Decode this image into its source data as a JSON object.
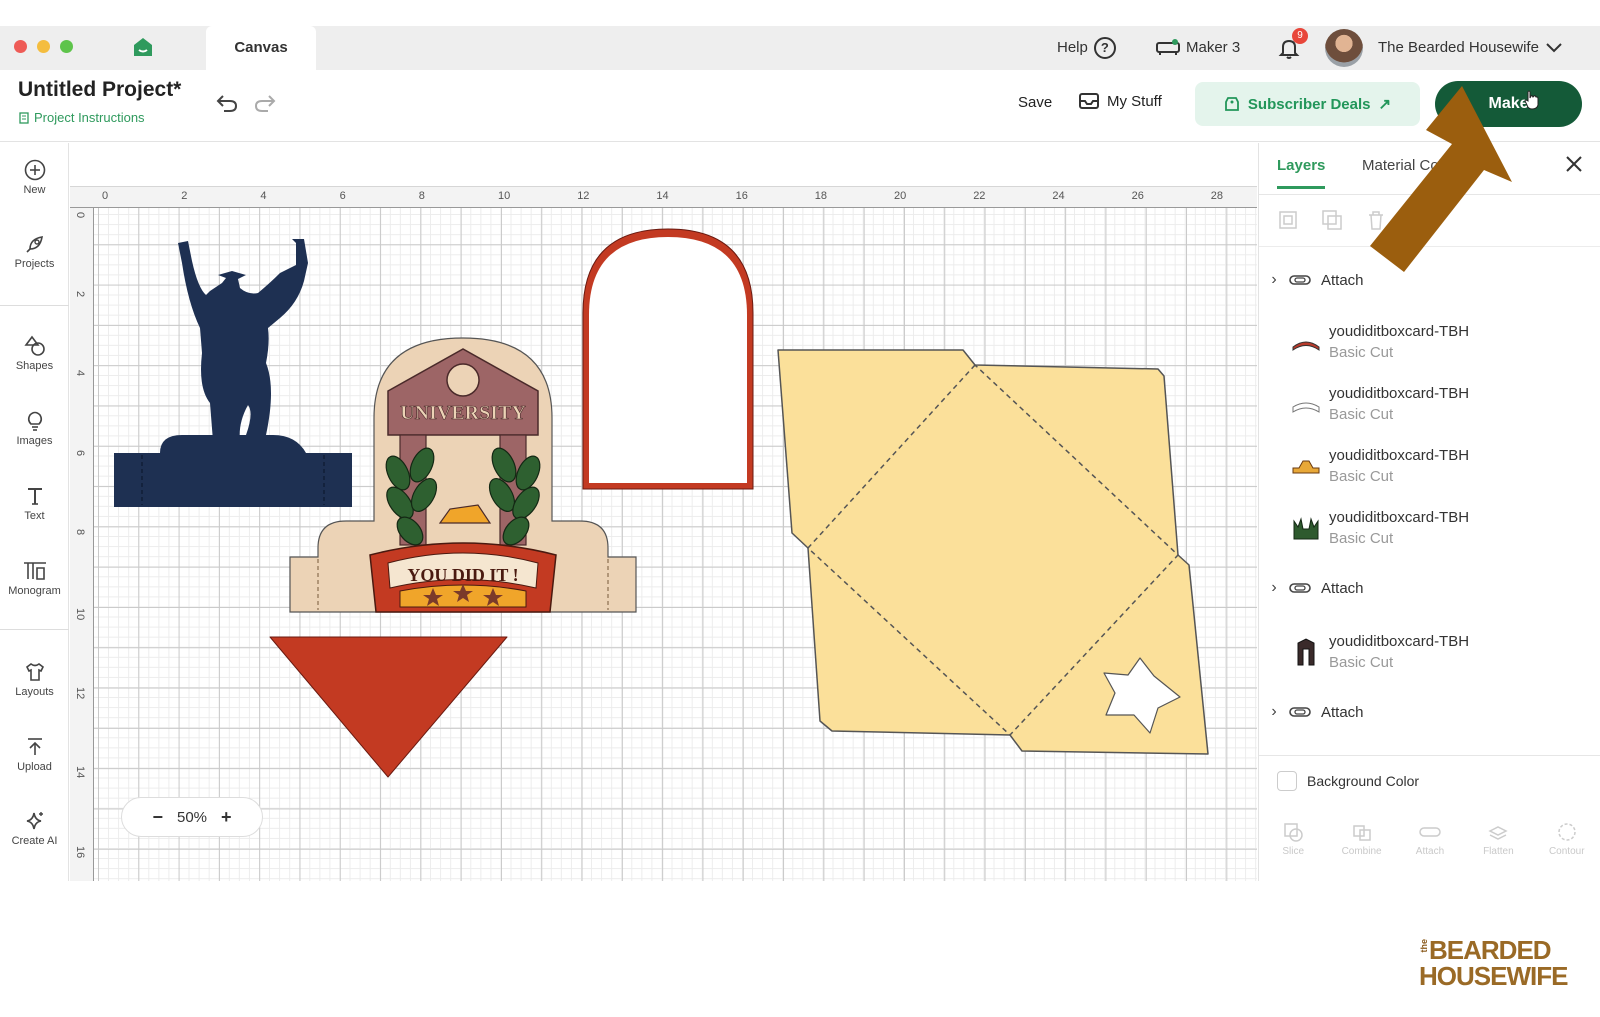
{
  "titlebar": {
    "tab_label": "Canvas",
    "help_label": "Help",
    "machine_label": "Maker 3",
    "notification_count": "9",
    "user_name": "The Bearded Housewife"
  },
  "header": {
    "project_title": "Untitled Project*",
    "project_instructions": "Project Instructions",
    "save_label": "Save",
    "mystuff_label": "My Stuff",
    "deals_label": "Subscriber Deals",
    "make_label": "Make"
  },
  "left_toolbar": {
    "items": [
      {
        "label": "New",
        "icon": "plus-circle-icon"
      },
      {
        "label": "Projects",
        "icon": "rocket-icon"
      },
      {
        "label": "Shapes",
        "icon": "shapes-icon"
      },
      {
        "label": "Images",
        "icon": "lightbulb-icon"
      },
      {
        "label": "Text",
        "icon": "text-icon"
      },
      {
        "label": "Monogram",
        "icon": "monogram-icon"
      },
      {
        "label": "Layouts",
        "icon": "shirt-icon"
      },
      {
        "label": "Upload",
        "icon": "upload-icon"
      },
      {
        "label": "Create AI",
        "icon": "sparkle-icon"
      }
    ]
  },
  "canvas": {
    "ruler_top": [
      "0",
      "2",
      "4",
      "6",
      "8",
      "10",
      "12",
      "14",
      "16",
      "18",
      "20",
      "22",
      "24",
      "26",
      "28"
    ],
    "ruler_left": [
      "0",
      "2",
      "4",
      "6",
      "8",
      "10",
      "12",
      "14",
      "16"
    ],
    "zoom": "50%",
    "zoom_minus": "−",
    "zoom_plus": "+",
    "badge_text_1": "UNIVERSITY",
    "badge_text_2": "YOU DID IT !"
  },
  "panel": {
    "tab_layers": "Layers",
    "tab_material": "Material Colors",
    "layers": [
      {
        "kind": "group",
        "label": "Attach"
      },
      {
        "kind": "item",
        "name": "youdiditboxcard-TBH",
        "sub": "Basic Cut",
        "thumb_color": "#b83a2b"
      },
      {
        "kind": "item",
        "name": "youdiditboxcard-TBH",
        "sub": "Basic Cut",
        "thumb_color": "#ffffff"
      },
      {
        "kind": "item",
        "name": "youdiditboxcard-TBH",
        "sub": "Basic Cut",
        "thumb_color": "#e8a838"
      },
      {
        "kind": "item",
        "name": "youdiditboxcard-TBH",
        "sub": "Basic Cut",
        "thumb_color": "#2e5a2e"
      },
      {
        "kind": "group",
        "label": "Attach"
      },
      {
        "kind": "item",
        "name": "youdiditboxcard-TBH",
        "sub": "Basic Cut",
        "thumb_color": "#3a2a2a"
      },
      {
        "kind": "group",
        "label": "Attach"
      }
    ],
    "background_color_label": "Background Color",
    "bottom_actions": [
      "Slice",
      "Combine",
      "Attach",
      "Flatten",
      "Contour"
    ]
  },
  "watermark": {
    "small": "the",
    "line1": "BEARDED",
    "line2": "HOUSEWIFE"
  },
  "colors": {
    "accent_green": "#2f9a5d",
    "make_button": "#145a38",
    "navy_shape": "#1e3052",
    "red_shape": "#c33a22",
    "envelope_yellow": "#fbe09a",
    "arrow_overlay": "#9b5e0e"
  }
}
